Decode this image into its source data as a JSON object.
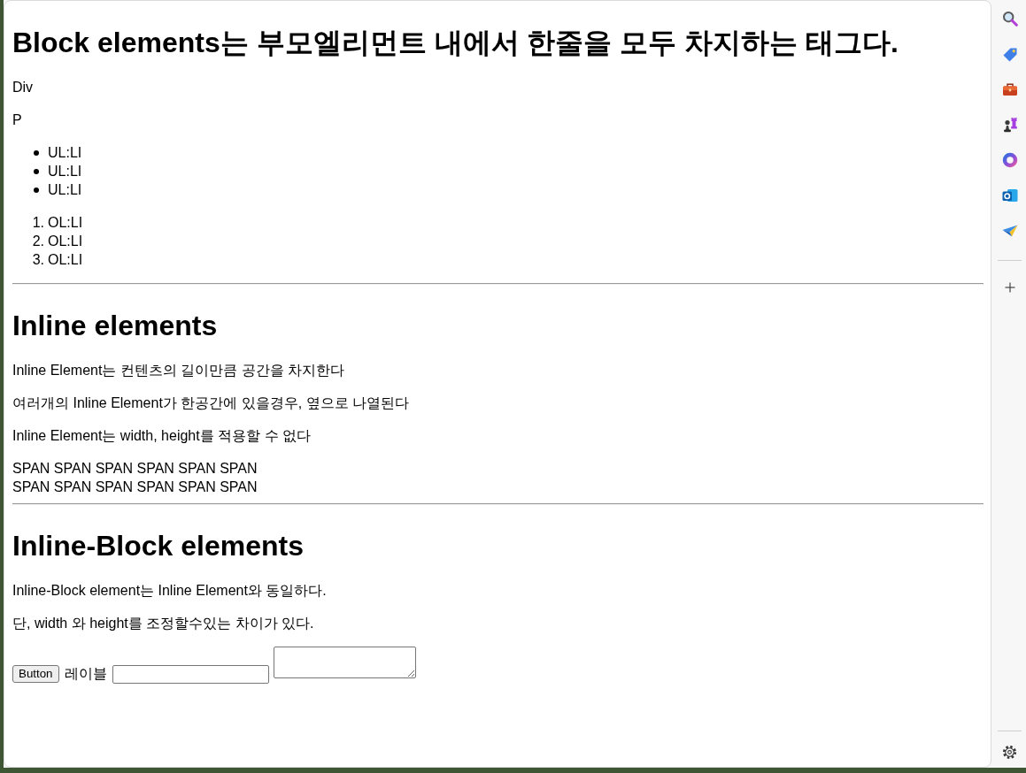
{
  "sections": [
    {
      "heading": "Block elements는 부모엘리먼트 내에서 한줄을 모두 차지하는 태그다.",
      "blocks": [
        {
          "kind": "text",
          "text": "Div"
        },
        {
          "kind": "paragraph",
          "text": "P"
        },
        {
          "kind": "bullet_list",
          "items": [
            "UL:LI",
            "UL:LI",
            "UL:LI"
          ]
        },
        {
          "kind": "numbered_list",
          "items": [
            {
              "number": "1.",
              "text": "OL:LI"
            },
            {
              "number": "2.",
              "text": "OL:LI"
            },
            {
              "number": "3.",
              "text": "OL:LI"
            }
          ]
        }
      ]
    },
    {
      "heading": "Inline elements",
      "blocks": [
        {
          "kind": "paragraph",
          "text": "Inline Element는 컨텐츠의 길이만큼 공간을 차지한다"
        },
        {
          "kind": "paragraph",
          "text": "여러개의 Inline Element가 한공간에 있을경우, 옆으로 나열된다"
        },
        {
          "kind": "paragraph",
          "text": "Inline Element는 width, height를 적용할 수 없다"
        },
        {
          "kind": "lines",
          "lines": [
            "SPAN SPAN SPAN SPAN SPAN SPAN",
            "SPAN SPAN SPAN SPAN SPAN SPAN"
          ]
        }
      ]
    },
    {
      "heading": "Inline-Block elements",
      "blocks": [
        {
          "kind": "paragraph",
          "text": "Inline-Block element는 Inline Element와 동일하다."
        },
        {
          "kind": "paragraph",
          "text": "단, width 와 height를 조정할수있는 차이가 있다."
        },
        {
          "kind": "controls",
          "items": [
            {
              "kind": "button",
              "label": "Button"
            },
            {
              "kind": "label",
              "text": "레이블"
            },
            {
              "kind": "text_input"
            },
            {
              "kind": "textarea"
            }
          ]
        }
      ]
    }
  ]
}
